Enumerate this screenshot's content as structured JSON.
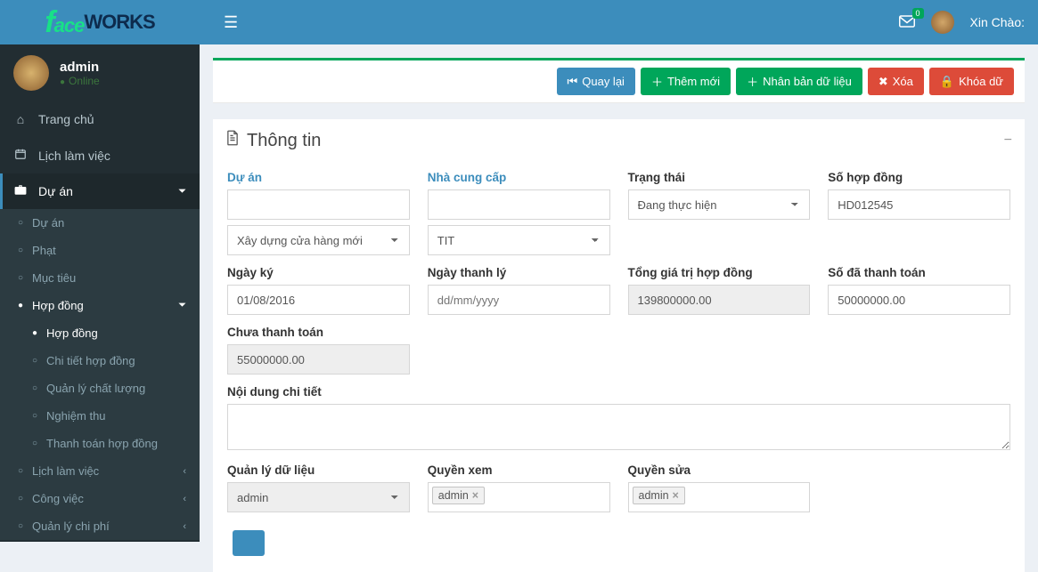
{
  "brand": {
    "face": "face",
    "works": "WORKS"
  },
  "header": {
    "mail_badge": "0",
    "greeting": "Xin Chào:"
  },
  "user_panel": {
    "name": "admin",
    "status": "Online"
  },
  "sidebar": {
    "items": [
      {
        "label": "Trang chủ",
        "icon": "home"
      },
      {
        "label": "Lịch làm việc",
        "icon": "calendar"
      },
      {
        "label": "Dự án",
        "icon": "briefcase",
        "expandable": true,
        "active": true
      }
    ],
    "du_an_children": [
      {
        "label": "Dự án"
      },
      {
        "label": "Phạt"
      },
      {
        "label": "Mục tiêu"
      },
      {
        "label": "Hợp đồng",
        "expandable": true,
        "active": true
      },
      {
        "label": "Lịch làm việc"
      },
      {
        "label": "Công việc"
      },
      {
        "label": "Quản lý chi phí"
      }
    ],
    "hop_dong_children": [
      {
        "label": "Hợp đồng",
        "active": true
      },
      {
        "label": "Chi tiết hợp đồng"
      },
      {
        "label": "Quản lý chất lượng"
      },
      {
        "label": "Nghiệm thu"
      },
      {
        "label": "Thanh toán hợp đồng"
      }
    ]
  },
  "actions": {
    "back": "Quay lại",
    "add": "Thêm mới",
    "clone": "Nhân bản dữ liệu",
    "delete": "Xóa",
    "lock": "Khóa dữ"
  },
  "box": {
    "title": "Thông tin"
  },
  "form": {
    "du_an_label": "Dự án",
    "du_an_blank": "",
    "du_an_select": "Xây dựng cửa hàng mới",
    "nha_cung_cap_label": "Nhà cung cấp",
    "nha_cung_cap_blank": "",
    "nha_cung_cap_select": "TIT",
    "trang_thai_label": "Trạng thái",
    "trang_thai_select": "Đang thực hiện",
    "so_hop_dong_label": "Số hợp đồng",
    "so_hop_dong_value": "HD012545",
    "ngay_ky_label": "Ngày ký",
    "ngay_ky_value": "01/08/2016",
    "ngay_thanh_ly_label": "Ngày thanh lý",
    "ngay_thanh_ly_value": "",
    "ngay_thanh_ly_placeholder": "dd/mm/yyyy",
    "tong_gia_tri_label": "Tổng giá trị hợp đồng",
    "tong_gia_tri_value": "139800000.00",
    "so_da_thanh_toan_label": "Số đã thanh toán",
    "so_da_thanh_toan_value": "50000000.00",
    "chua_thanh_toan_label": "Chưa thanh toán",
    "chua_thanh_toan_value": "55000000.00",
    "noi_dung_label": "Nội dung chi tiết",
    "noi_dung_value": "",
    "quan_ly_du_lieu_label": "Quản lý dữ liệu",
    "quan_ly_du_lieu_value": "admin",
    "quyen_xem_label": "Quyền xem",
    "quyen_xem_tag": "admin",
    "quyen_sua_label": "Quyền sửa",
    "quyen_sua_tag": "admin"
  }
}
